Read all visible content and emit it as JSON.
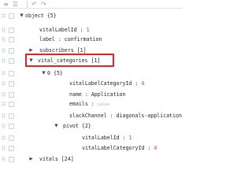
{
  "toolbar": {
    "icons": [
      "menu-icon",
      "properties-icon",
      "undo-icon",
      "redo-icon"
    ],
    "glyphs": [
      "≡",
      "☰",
      "↶",
      "↷"
    ]
  },
  "tree": {
    "rows": [
      {
        "key": "object",
        "sep": " ",
        "value": "{5}",
        "kind": "group",
        "state": "expanded"
      },
      {
        "key": "vitalLabelId",
        "sep": " : ",
        "value": "1",
        "kind": "num"
      },
      {
        "key": "label",
        "sep": " : ",
        "value": "confirmation",
        "kind": "str"
      },
      {
        "key": "subscribers",
        "sep": " ",
        "value": "[1]",
        "kind": "group",
        "state": "collapsed"
      },
      {
        "key": "vital_categories",
        "sep": " ",
        "value": "[1]",
        "kind": "group",
        "state": "expanded"
      },
      {
        "key": "0",
        "sep": " ",
        "value": "{5}",
        "kind": "group",
        "state": "expanded"
      },
      {
        "key": "vitalLabelCategoryId",
        "sep": " : ",
        "value": "4",
        "kind": "num"
      },
      {
        "key": "name",
        "sep": " : ",
        "value": "Application",
        "kind": "str"
      },
      {
        "key": "emails",
        "sep": " : ",
        "value": "value",
        "kind": "empty"
      },
      {
        "key": "slackChannel",
        "sep": " : ",
        "value": "diagonals-application",
        "kind": "str"
      },
      {
        "key": "pivot",
        "sep": " ",
        "value": "{2}",
        "kind": "group",
        "state": "expanded"
      },
      {
        "key": "vitalLabelId",
        "sep": " : ",
        "value": "1",
        "kind": "num"
      },
      {
        "key": "vitalLabelCategoryId",
        "sep": " : ",
        "value": "4",
        "kind": "num"
      },
      {
        "key": "vitals",
        "sep": " ",
        "value": "[24]",
        "kind": "group",
        "state": "collapsed"
      }
    ]
  },
  "colors": {
    "number_value": "#e53935",
    "highlight_border": "#e3231f",
    "placeholder": "#b0b5ba"
  }
}
